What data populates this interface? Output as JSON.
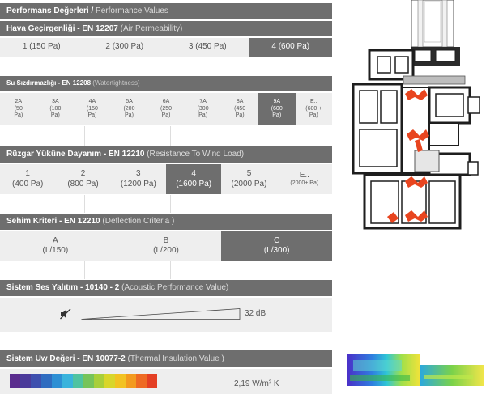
{
  "performance": {
    "title_tr": "Performans Değerleri /",
    "title_en": "Performance Values"
  },
  "air": {
    "title_tr": "Hava Geçirgenliği - EN 12207",
    "title_en": "(Air Permeability)",
    "options": [
      {
        "label": "1 (150 Pa)",
        "selected": false
      },
      {
        "label": "2 (300 Pa)",
        "selected": false
      },
      {
        "label": "3 (450 Pa)",
        "selected": false
      },
      {
        "label": "4 (600 Pa)",
        "selected": true
      }
    ]
  },
  "water": {
    "title_tr": "Su Sızdırmazlığı - EN 12208",
    "title_en": "(Watertightness)",
    "options": [
      {
        "label": "2A",
        "sub": "(50 Pa)",
        "selected": false
      },
      {
        "label": "3A",
        "sub": "(100 Pa)",
        "selected": false
      },
      {
        "label": "4A",
        "sub": "(150 Pa)",
        "selected": false
      },
      {
        "label": "5A",
        "sub": "(200 Pa)",
        "selected": false
      },
      {
        "label": "6A",
        "sub": "(250 Pa)",
        "selected": false
      },
      {
        "label": "7A",
        "sub": "(300 Pa)",
        "selected": false
      },
      {
        "label": "8A",
        "sub": "(450 Pa)",
        "selected": false
      },
      {
        "label": "9A",
        "sub": "(600 Pa)",
        "selected": true
      },
      {
        "label": "E..",
        "sub": "(600 + Pa)",
        "selected": false
      }
    ]
  },
  "wind": {
    "title_tr": "Rüzgar Yüküne Dayanım - EN 12210",
    "title_en": "(Resistance To Wind Load)",
    "options": [
      {
        "label": "1",
        "sub": "(400 Pa)",
        "selected": false
      },
      {
        "label": "2",
        "sub": "(800 Pa)",
        "selected": false
      },
      {
        "label": "3",
        "sub": "(1200 Pa)",
        "selected": false
      },
      {
        "label": "4",
        "sub": "(1600 Pa)",
        "selected": true
      },
      {
        "label": "5",
        "sub": "(2000 Pa)",
        "selected": false
      },
      {
        "label": "E..",
        "sub": "(2000+ Pa)",
        "selected": false
      }
    ]
  },
  "deflection": {
    "title_tr": "Sehim Kriteri - EN 12210",
    "title_en": "(Deflection Criteria )",
    "options": [
      {
        "label": "A",
        "sub": "(L/150)",
        "selected": false
      },
      {
        "label": "B",
        "sub": "(L/200)",
        "selected": false
      },
      {
        "label": "C",
        "sub": "(L/300)",
        "selected": true
      }
    ]
  },
  "acoustic": {
    "title_tr": "Sistem Ses Yalıtım - 10140 - 2",
    "title_en": "(Acoustic Performance Value)",
    "value": "32 dB",
    "icon": "muted-speaker-icon",
    "level_fraction": 1.0
  },
  "thermal": {
    "title_tr": "Sistem Uw Değeri  - EN 10077-2",
    "title_en": "(Thermal Insulation Value )",
    "value": "2,19 W/m² K",
    "scale_colors": [
      "#5b2d8e",
      "#4b3a9a",
      "#3e4fae",
      "#2f6cc0",
      "#2d8fd4",
      "#39b3dc",
      "#4fc3a1",
      "#76c45a",
      "#a8cf3a",
      "#d8d62a",
      "#f2c221",
      "#f39a1e",
      "#ee6a23",
      "#e43f24"
    ]
  },
  "colors": {
    "header_bg": "#6e6e6e",
    "row_bg": "#eeeeee",
    "selected_bg": "#6e6e6e",
    "gasket": "#e8451f"
  }
}
